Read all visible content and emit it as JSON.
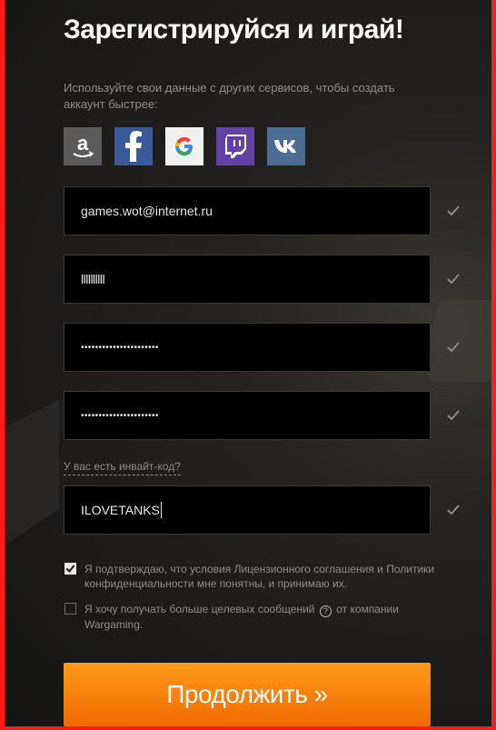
{
  "title": "Зарегистрируйся и играй!",
  "intro": "Используйте свои данные с других сервисов, чтобы создать аккаунт быстрее:",
  "social": [
    {
      "name": "amazon",
      "icon": "amazon-icon"
    },
    {
      "name": "facebook",
      "icon": "facebook-icon"
    },
    {
      "name": "google",
      "icon": "google-icon"
    },
    {
      "name": "twitch",
      "icon": "twitch-icon"
    },
    {
      "name": "vk",
      "icon": "vk-icon"
    }
  ],
  "fields": {
    "email": "games.wot@internet.ru",
    "nickname": "llllllllll",
    "password": "••••••••••••••••••••••",
    "password_confirm": "••••••••••••••••••••••",
    "invite_code": "ILOVETANKS"
  },
  "invite_link": "У вас есть инвайт-код?",
  "agree_terms": {
    "checked": true,
    "text": "Я подтверждаю, что условия Лицензионного соглашения и Политики конфиденциальности мне понятны, и принимаю их."
  },
  "marketing": {
    "checked": false,
    "text_before": "Я хочу получать больше целевых сообщений",
    "help": "?",
    "text_after": "от компании Wargaming."
  },
  "submit_label": "Продолжить »",
  "colors": {
    "accent": "#f47a00",
    "frame": "#ff1a1a",
    "panel": "#1b1a19"
  }
}
